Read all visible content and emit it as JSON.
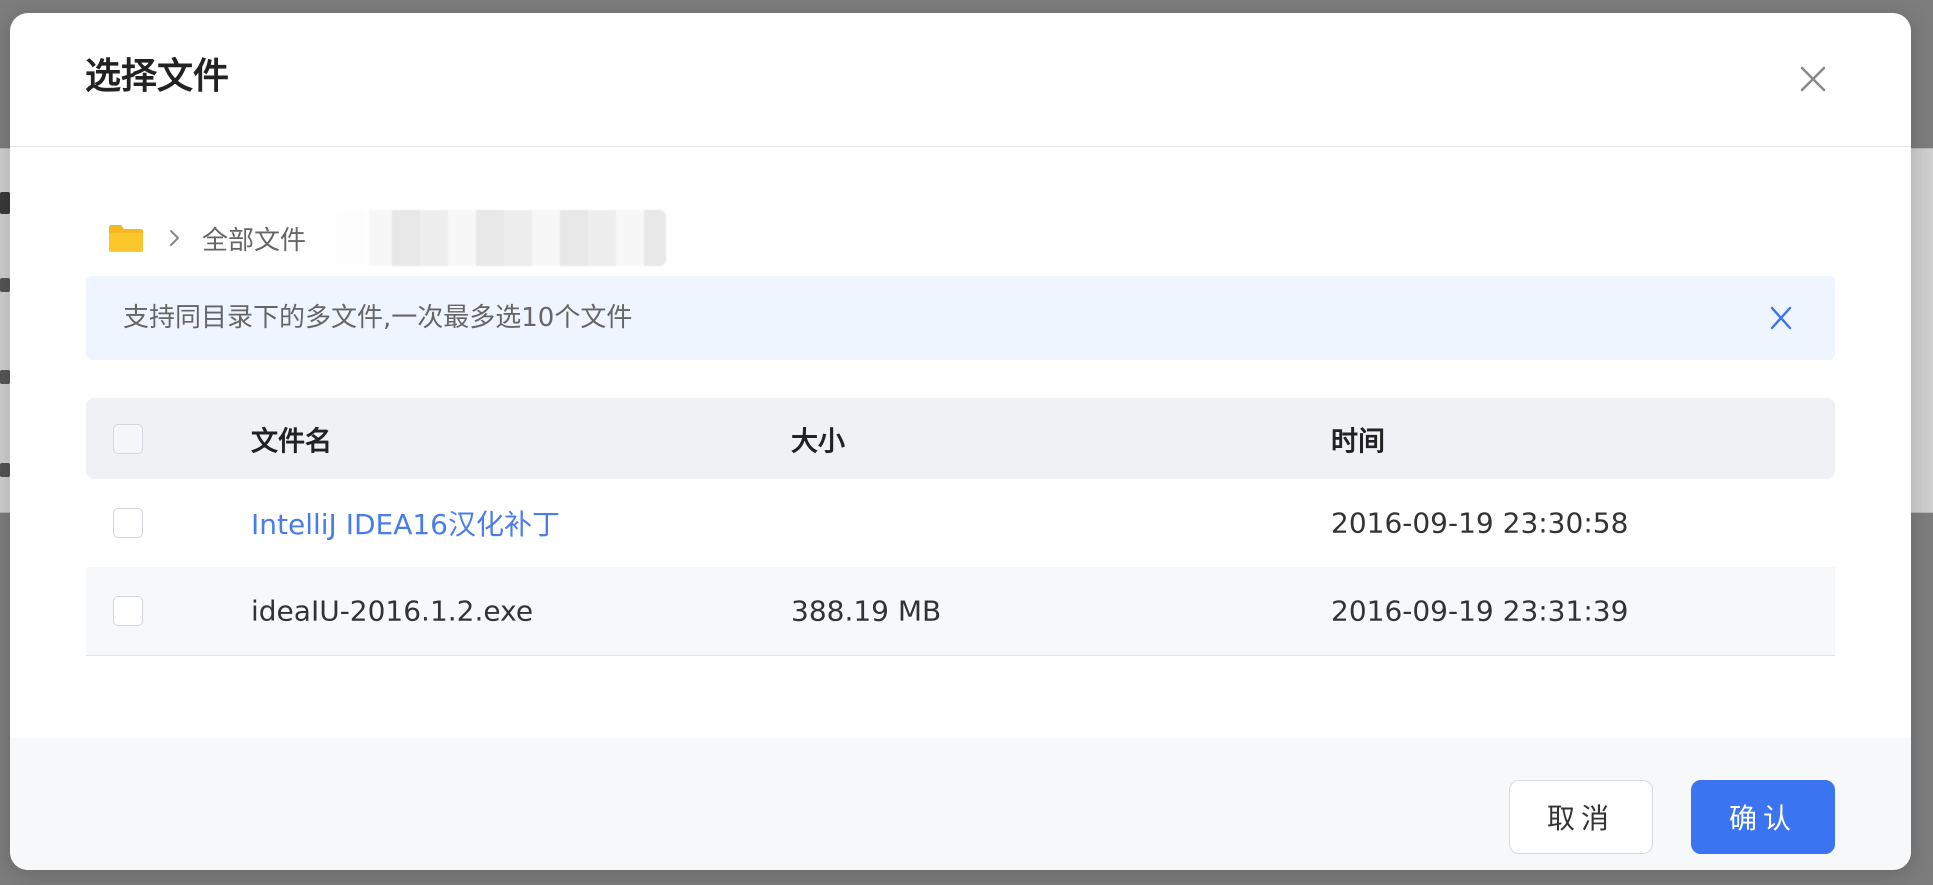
{
  "dialog": {
    "title": "选择文件"
  },
  "breadcrumb": {
    "root_label": "全部文件"
  },
  "notice": {
    "text": "支持同目录下的多文件,一次最多选10个文件",
    "close_label": "X"
  },
  "table": {
    "columns": {
      "name": "文件名",
      "size": "大小",
      "time": "时间"
    },
    "rows": [
      {
        "name": "IntelliJ IDEA16汉化补丁",
        "size": "",
        "time": "2016-09-19 23:30:58",
        "is_folder": true
      },
      {
        "name": "ideaIU-2016.1.2.exe",
        "size": "388.19 MB",
        "time": "2016-09-19 23:31:39",
        "is_folder": false
      }
    ]
  },
  "footer": {
    "cancel_label": "取消",
    "confirm_label": "确认"
  },
  "colors": {
    "accent": "#3b74f0",
    "link": "#4a7dec",
    "folder": "#f5b920",
    "notice_bg": "#eef5ff"
  },
  "icons": {
    "close": "close-icon",
    "folder": "folder-icon",
    "chevron": "chevron-right-icon",
    "notice_close": "notice-close-icon"
  }
}
